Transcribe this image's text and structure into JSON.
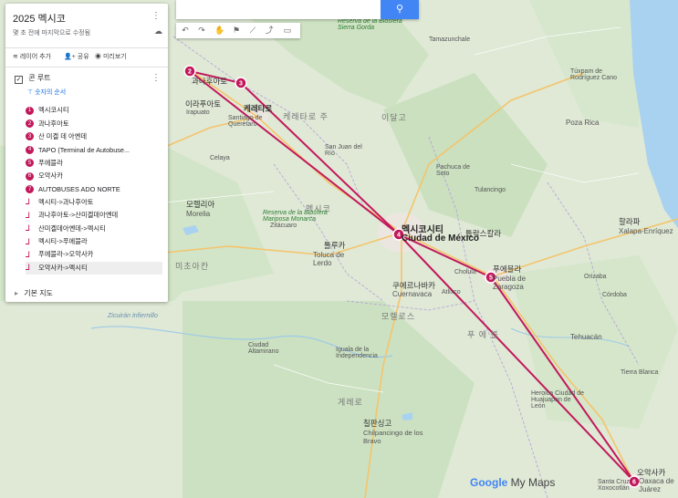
{
  "map": {
    "colors": {
      "land": "#dfe9d6",
      "forest": "#c8dfbf",
      "water": "#a9d2f0",
      "route": "#c2185b",
      "highway": "#f5c46b",
      "urban": "#ece6e0"
    }
  },
  "panel": {
    "title": "2025 멕시코",
    "subtitle": "몇 초 전에 마지막으로 수정됨",
    "toolbar": {
      "add_layer": "레이어 추가",
      "share": "공유",
      "preview": "미리보기"
    },
    "layer": {
      "name": "콘 루트",
      "style": "숫자의 순서"
    },
    "items": [
      {
        "type": "point",
        "num": "1",
        "label": "멕시코시티"
      },
      {
        "type": "point",
        "num": "2",
        "label": "과나후아토"
      },
      {
        "type": "point",
        "num": "3",
        "label": "산 미겔 데 아옌데"
      },
      {
        "type": "point",
        "num": "4",
        "label": "TAPO (Terminal de Autobuse..."
      },
      {
        "type": "point",
        "num": "5",
        "label": "푸에블라"
      },
      {
        "type": "point",
        "num": "6",
        "label": "오악사카"
      },
      {
        "type": "point",
        "num": "7",
        "label": "AUTOBUSES ADO NORTE"
      },
      {
        "type": "route",
        "label": "멕시티->과나후아토"
      },
      {
        "type": "route",
        "label": "과나후아토->산미겔데아옌데"
      },
      {
        "type": "route",
        "label": "산미겔데아옌데->멕시티"
      },
      {
        "type": "route",
        "label": "멕시티->푸에블라"
      },
      {
        "type": "route",
        "label": "푸에블라->오악사카"
      },
      {
        "type": "route",
        "label": "오악사카->멕시티"
      }
    ],
    "base_map": "기본 지도"
  },
  "search": {
    "button_icon": "search-icon"
  },
  "markers": [
    {
      "num": "2"
    },
    {
      "num": "3"
    },
    {
      "num": "4"
    },
    {
      "num": "5"
    },
    {
      "num": "6"
    }
  ],
  "labels": {
    "mexico_city": "멕시코시티",
    "ciudad": "Ciudad de México",
    "queretaro_kr": "케레타로",
    "queretaro": "Santiago de Querétaro",
    "queretaro_state": "케레타로 주",
    "guanajuato": "과나후아토",
    "irapuato_kr": "이라푸아토",
    "irapuato": "Irapuato",
    "morelia_kr": "모렐리아",
    "morelia": "Morelia",
    "toluca_kr": "톨루카",
    "toluca": "Toluca de Lerdo",
    "puebla_kr": "푸에블라",
    "puebla": "Puebla de Zaragoza",
    "cuernavaca_kr": "쿠에르나바카",
    "cuernavaca": "Cuernavaca",
    "oaxaca_kr": "오악사카",
    "oaxaca": "Oaxaca de Juárez",
    "chilpancingo_kr": "칠판싱고",
    "chilpancingo": "Chilpancingo de los Bravo",
    "tlaxcala_kr": "틀락스칼라",
    "xalapa_kr": "할라파",
    "xalapa": "Xalapa-Enríquez",
    "hidalgo": "이달고",
    "mexico_state": "멕시코",
    "michoacan": "미초아칸",
    "morelos": "모렐로스",
    "guerrero": "게레로",
    "puebla_state": "푸 에 블",
    "poza_rica": "Poza Rica",
    "tehuacan": "Tehuacán",
    "pachuca": "Pachuca de Soto",
    "celaya": "Celaya",
    "cordoba": "Córdoba",
    "orizaba": "Orizaba",
    "tampico": "Tamazunchale",
    "biosphere": "Reserva de la Biosfera Sierra Gorda",
    "biosphere2": "Reserva de la Biosfera Mariposa Monarca",
    "zicuiran": "Zicuirán Infiernillo",
    "tuxpan": "Túxpam de Rodríguez Cano",
    "iguala": "Iguala de la Independencia",
    "altamirano": "Ciudad Altamirano",
    "tierra_blanca": "Tierra Blanca",
    "cholula": "Cholula",
    "atlixco": "Atlixco",
    "huajuapan": "Heroica Ciudad de Huajuapan de León",
    "xoxo": "Santa Cruz Xoxocotlán",
    "zitacuaro": "Zitácuaro",
    "san_juan_rio": "San Juan del Río",
    "tulancingo": "Tulancingo"
  },
  "brand": {
    "google": "Google",
    "mymaps": " My Maps"
  }
}
